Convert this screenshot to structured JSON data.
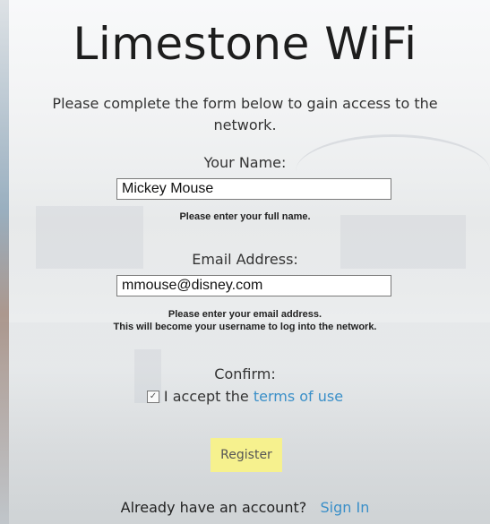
{
  "title": "Limestone WiFi",
  "subtitle": "Please complete the form below to gain access to the network.",
  "name_field": {
    "label": "Your Name:",
    "value": "Mickey Mouse",
    "hint": "Please enter your full name."
  },
  "email_field": {
    "label": "Email Address:",
    "value": "mmouse@disney.com",
    "hint_line1": "Please enter your email address.",
    "hint_line2": "This will become your username to log into the network."
  },
  "confirm": {
    "label": "Confirm:",
    "checkbox_checked": true,
    "accept_text": "I accept the",
    "terms_link": "terms of use"
  },
  "register_button": "Register",
  "signin": {
    "text": "Already have an account?",
    "link": "Sign In"
  },
  "colors": {
    "link": "#3a8fc8",
    "register_bg": "#f6f18e"
  },
  "icons": {
    "checkbox": "check-icon"
  }
}
